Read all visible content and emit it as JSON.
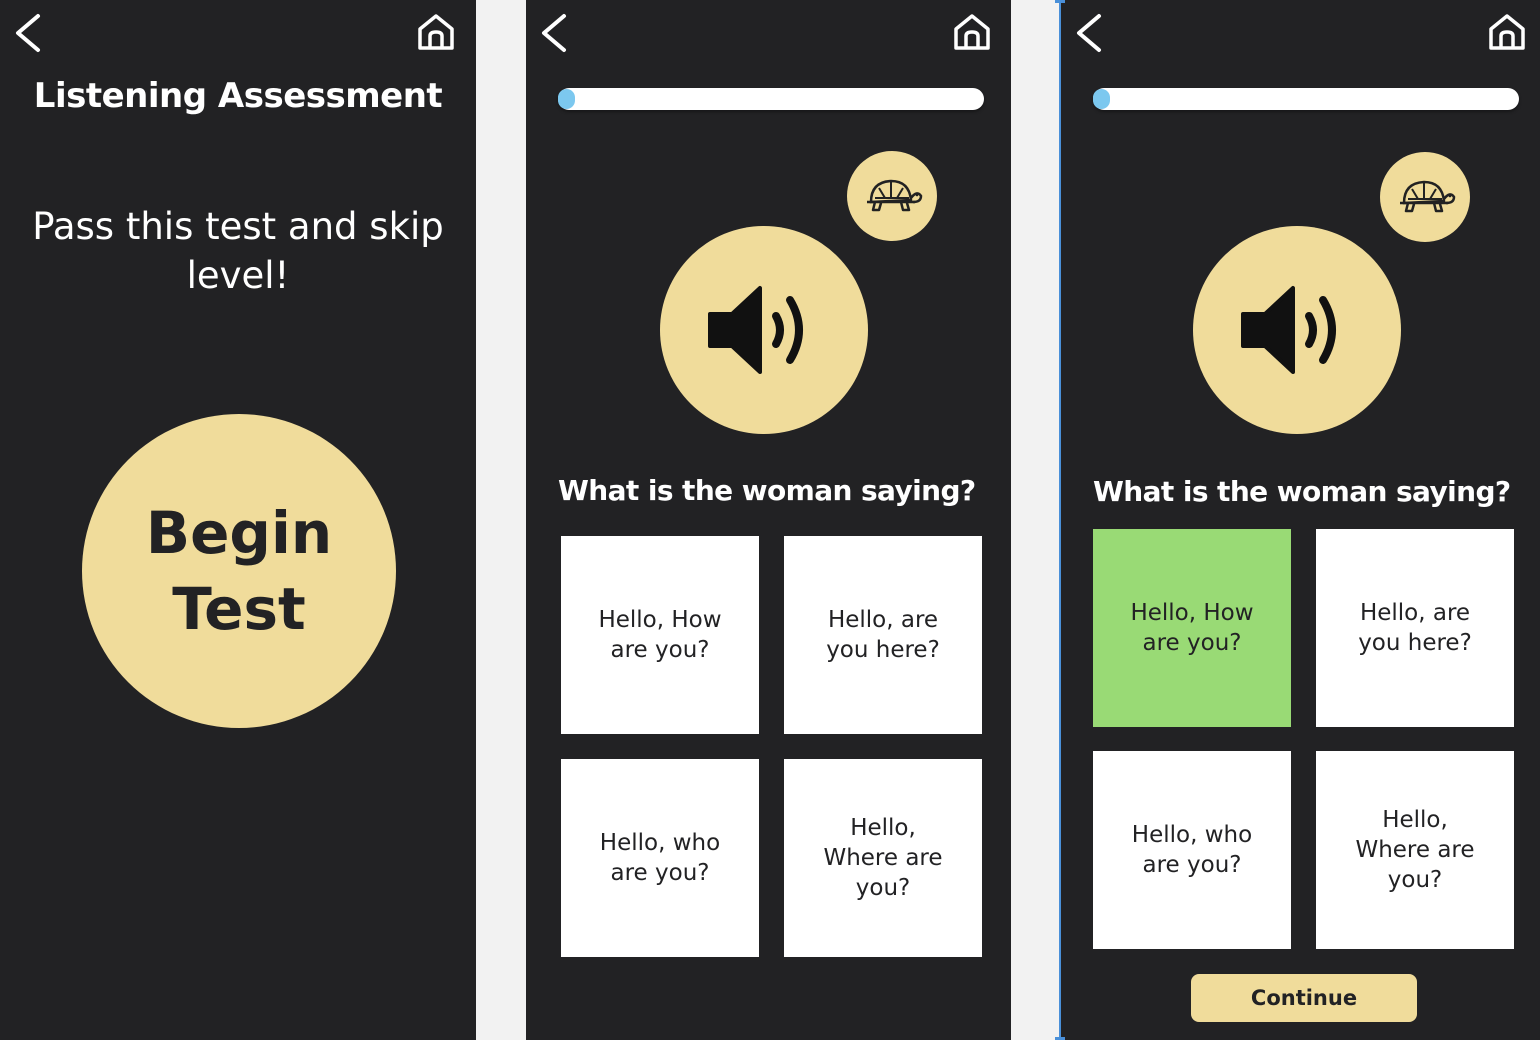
{
  "screen1": {
    "title": "Listening Assessment",
    "subtitle": "Pass this test and skip level!",
    "begin_label": "Begin Test"
  },
  "screen2": {
    "progress": 0.04,
    "question": "What is the woman saying?",
    "options": [
      "Hello, How are you?",
      "Hello, are you here?",
      "Hello, who are you?",
      "Hello, Where are you?"
    ]
  },
  "screen3": {
    "progress": 0.04,
    "question": "What is the woman saying?",
    "options": [
      "Hello, How are you?",
      "Hello, are you here?",
      "Hello, who are you?",
      "Hello, Where are you?"
    ],
    "selected_option": "Hello, How are you?",
    "continue_label": "Continue"
  },
  "icons": [
    "back-arrow-icon",
    "home-icon",
    "turtle-icon",
    "speaker-icon"
  ],
  "colors": {
    "background": "#222224",
    "accent": "#f0dc9b",
    "progress_fill": "#7cc8ef",
    "correct": "#99da75",
    "card": "#ffffff"
  }
}
